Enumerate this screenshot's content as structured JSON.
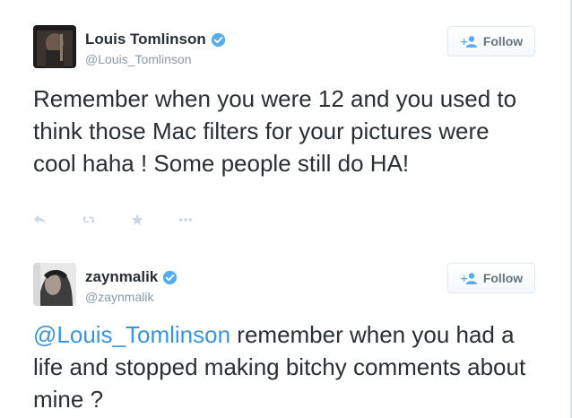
{
  "tweets": [
    {
      "name": "Louis Tomlinson",
      "handle": "@Louis_Tomlinson",
      "verified": true,
      "follow_label": "Follow",
      "text": "Remember when you were 12 and you used to think those Mac filters for your pictures were cool haha ! Some people still do HA!",
      "actions": [
        "reply-icon",
        "retweet-icon",
        "favorite-icon",
        "more-icon"
      ]
    },
    {
      "name": "zaynmalik",
      "handle": "@zaynmalik",
      "verified": true,
      "follow_label": "Follow",
      "text_mention": "@Louis_Tomlinson",
      "text_rest": " remember when you had a life and stopped making bitchy comments about mine ?"
    }
  ],
  "colors": {
    "mention": "#3b94d9",
    "verified": "#55acee",
    "muted": "#8899a6",
    "text": "#292f33"
  }
}
